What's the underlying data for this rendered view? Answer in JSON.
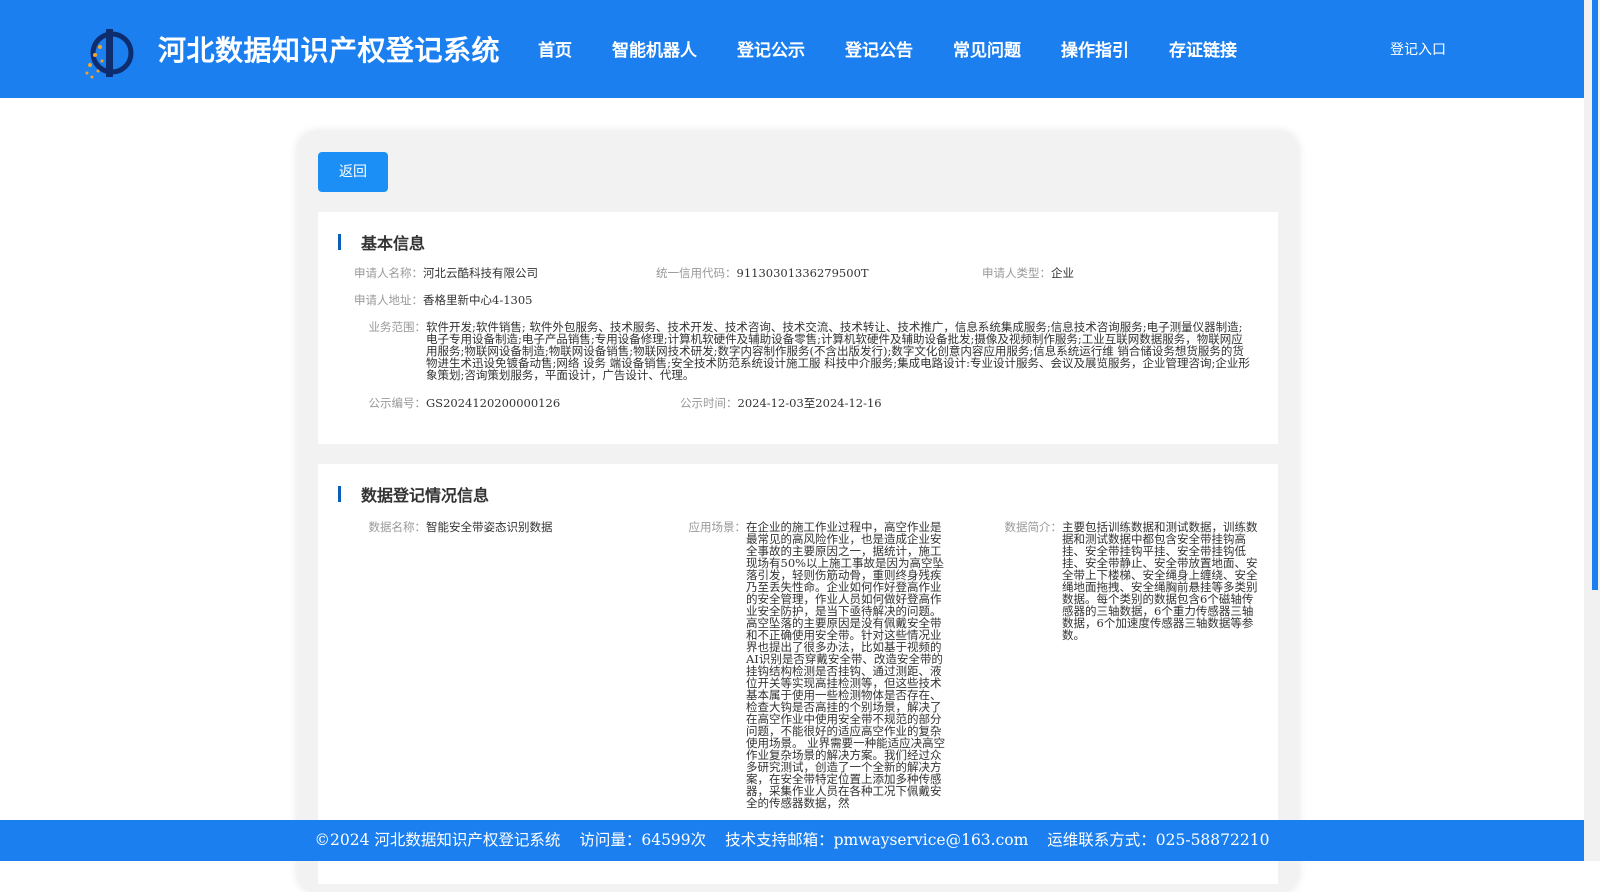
{
  "header": {
    "title": "河北数据知识产权登记系统",
    "nav": [
      "首页",
      "智能机器人",
      "登记公示",
      "登记公告",
      "常见问题",
      "操作指引",
      "存证链接"
    ],
    "login": "登记入口"
  },
  "back_label": "返回",
  "basic": {
    "title": "基本信息",
    "applicant_name_label": "申请人名称：",
    "applicant_name": "河北云酷科技有限公司",
    "credit_code_label": "统一信用代码：",
    "credit_code": "91130301336279500T",
    "applicant_type_label": "申请人类型：",
    "applicant_type": "企业",
    "address_label": "申请人地址：",
    "address": "香格里新中心4-1305",
    "scope_label": "业务范围：",
    "scope": "软件开发;软件销售; 软件外包服务、技术服务、技术开发、技术咨询、技术交流、技术转让、技术推广，信息系统集成服务;信息技术咨询服务;电子测量仪器制造;电子专用设备制造;电子产品销售;专用设备修理;计算机软硬件及辅助设备零售;计算机软硬件及辅助设备批发;摄像及视频制作服务;工业互联网数据服务，物联网应用服务;物联网设备制造;物联网设备销售;物联网技术研发;数字内容制作服务(不含出版发行);数字文化创意内容应用服务;信息系统运行维 销合储设务想货服务的货物进生术迅设免镀备动售;网络 设务 端设备销售;安全技术防范系统设计施工服 科技中介服务;集成电路设计:专业设计服务、会议及展览服务，企业管理咨询;企业形象策划;咨询策划服务，平面设计，广告设计、代理。",
    "pub_no_label": "公示编号：",
    "pub_no": "GS2024120200000126",
    "pub_time_label": "公示时间：",
    "pub_time": "2024-12-03至2024-12-16"
  },
  "data_info": {
    "title": "数据登记情况信息",
    "data_name_label": "数据名称：",
    "data_name": "智能安全带姿态识别数据",
    "scenario_label": "应用场景：",
    "scenario": "在企业的施工作业过程中，高空作业是最常见的高风险作业，也是造成企业安全事故的主要原因之一，据统计，施工现场有50%以上施工事故是因为高空坠落引发，轻则伤筋动骨，重则终身残疾乃至丢失性命。企业如何作好登高作业的安全管理，作业人员如何做好登高作业安全防护，是当下亟待解决的问题。 高空坠落的主要原因是没有佩戴安全带和不正确使用安全带。针对这些情况业界也提出了很多办法，比如基于视频的AI识别是否穿戴安全带、改造安全带的挂钩结构检测是否挂钩、通过测距、液位开关等实现高挂检测等，但这些技术基本属于使用一些检测物体是否存在、检查大钩是否高挂的个别场景，解决了在高空作业中使用安全带不规范的部分问题，不能很好的适应高空作业的复杂使用场景。 业界需要一种能适应决高空作业复杂场景的解决方案。我们经过众多研究测试，创造了一个全新的解决方案，在安全带特定位置上添加多种传感器，采集作业人员在各种工况下佩戴安全的传感器数据，然",
    "intro_label": "数据简介：",
    "intro": "主要包括训练数据和测试数据，训练数据和测试数据中都包含安全带挂钩高挂、安全带挂钩平挂、安全带挂钩低挂、安全带静止、安全带放置地面、安全带上下楼梯、安全绳身上缠绕、安全绳地面拖拽、安全绳胸前悬挂等多类别数据。每个类别的数据包含6个磁轴传感器的三轴数据，6个重力传感器三轴数据，6个加速度传感器三轴数据等参数。"
  },
  "footer": {
    "copyright": "©2024 河北数据知识产权登记系统",
    "visits": "访问量：64599次",
    "email": "技术支持邮箱：pmwayservice@163.com",
    "phone": "运维联系方式：025-58872210"
  }
}
